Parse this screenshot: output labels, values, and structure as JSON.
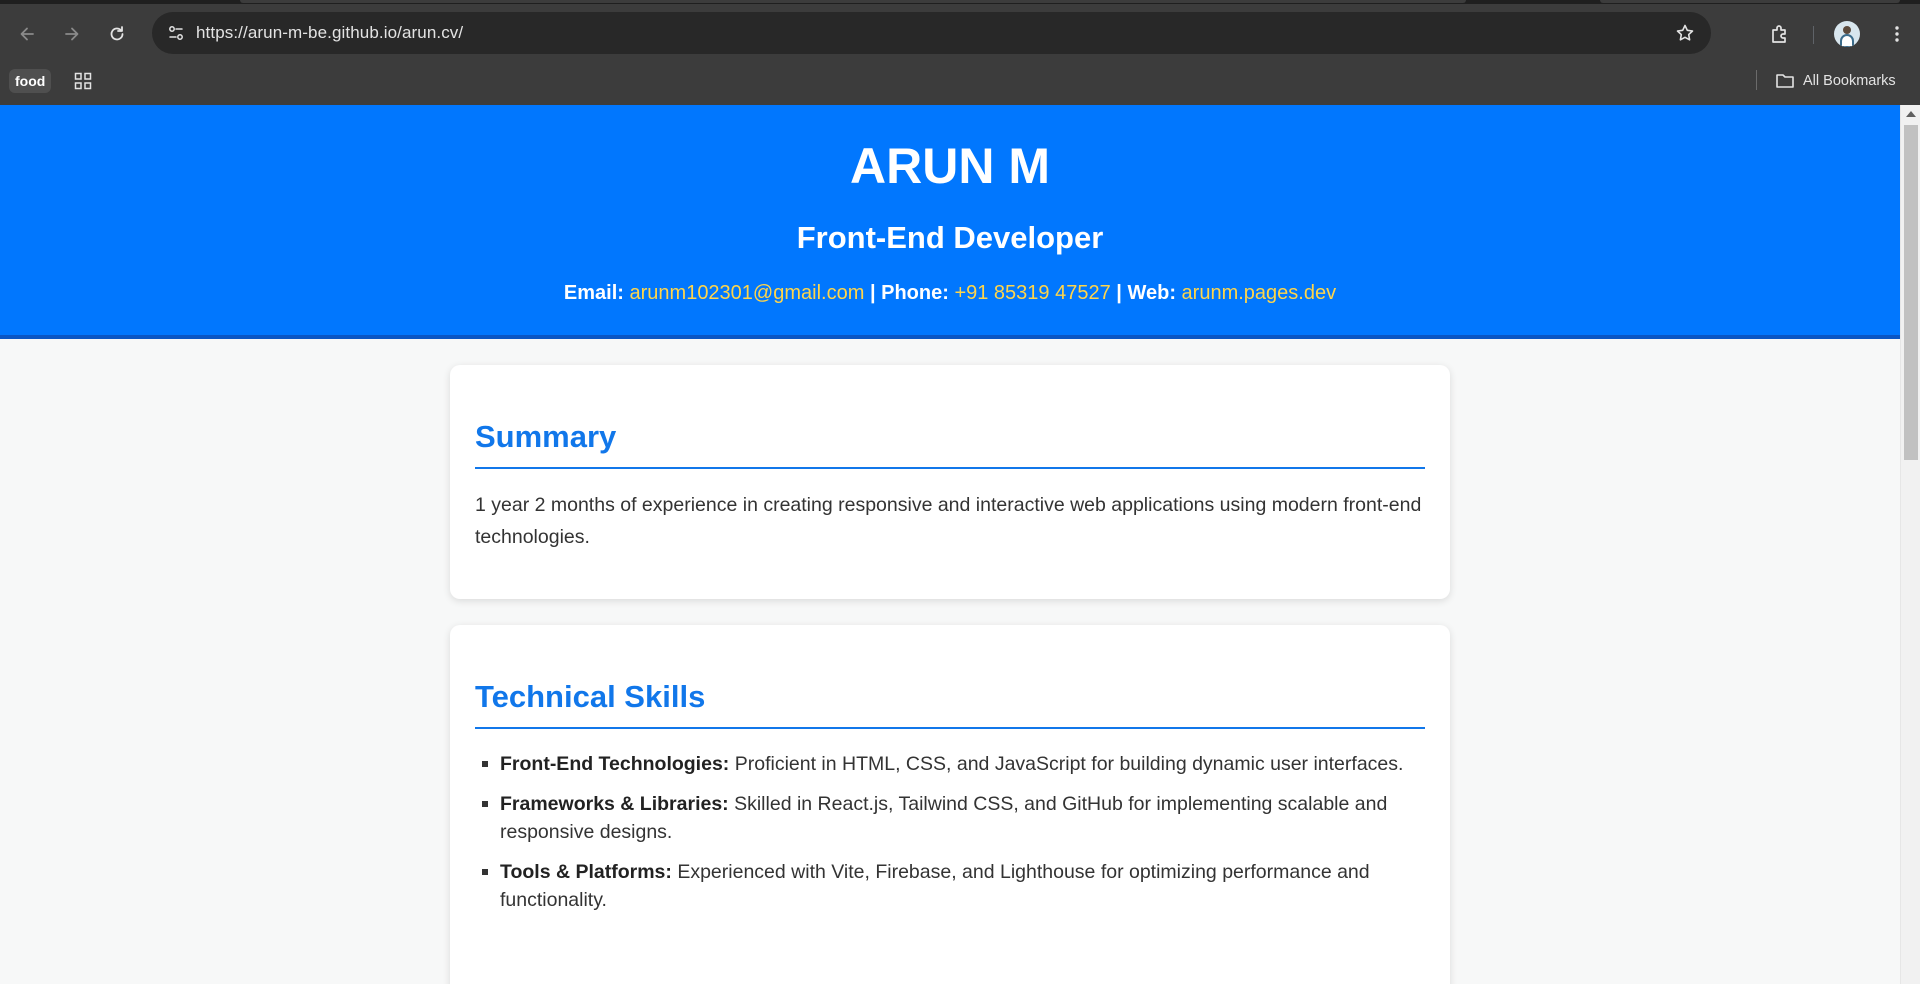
{
  "browser": {
    "url": "https://arun-m-be.github.io/arun.cv/",
    "bookmarks": {
      "items": [
        {
          "label": "food"
        }
      ],
      "all_bookmarks_label": "All Bookmarks"
    }
  },
  "page": {
    "name": "ARUN M",
    "role": "Front-End Developer",
    "contact": {
      "email_label": "Email:",
      "email": "arunm102301@gmail.com",
      "separator": "|",
      "phone_label": "Phone:",
      "phone": "+91 85319 47527",
      "web_label": "Web:",
      "web": "arunm.pages.dev"
    },
    "summary": {
      "title": "Summary",
      "text": "1 year 2 months of experience in creating responsive and interactive web applications using modern front-end technologies."
    },
    "skills": {
      "title": "Technical Skills",
      "items": [
        {
          "label": "Front-End Technologies:",
          "text": "Proficient in HTML, CSS, and JavaScript for building dynamic user interfaces."
        },
        {
          "label": "Frameworks & Libraries:",
          "text": "Skilled in React.js, Tailwind CSS, and GitHub for implementing scalable and responsive designs."
        },
        {
          "label": "Tools & Platforms:",
          "text": "Experienced with Vite, Firebase, and Lighthouse for optimizing performance and functionality."
        }
      ]
    }
  },
  "colors": {
    "header_bg": "#0177fe",
    "heading_blue": "#1177ea",
    "link_yellow": "#ffd54a",
    "chrome_bg": "#3c3c3c"
  },
  "icons": [
    "back-arrow-icon",
    "forward-arrow-icon",
    "reload-icon",
    "site-info-icon",
    "star-icon",
    "extensions-icon",
    "profile-avatar",
    "kebab-menu-icon",
    "apps-grid-icon",
    "folder-icon"
  ]
}
